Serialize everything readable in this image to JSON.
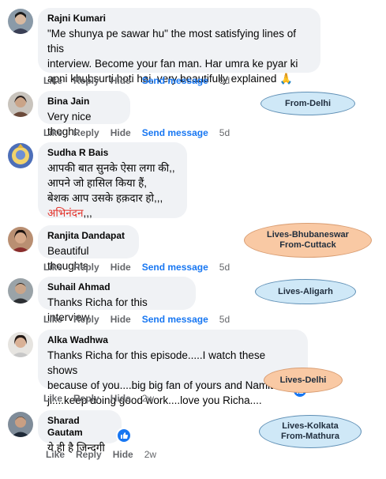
{
  "actions": {
    "like": "Like",
    "reply": "Reply",
    "hide": "Hide",
    "send_message": "Send message"
  },
  "comments": [
    {
      "name": "Rajni Kumari",
      "text": "\"Me shunya pe sawar hu\" the most satisfying lines of this\ninterview. Become your fan man. Har umra ke pyar ki\napni khubsurti hoti hai, very beautifully explained 🙏",
      "time": "5d"
    },
    {
      "name": "Bina Jain",
      "text": "Very nice thoght",
      "time": "5d"
    },
    {
      "name": "Sudha R Bais",
      "text": "आपकी बात सुनके ऐसा लगा की,,\nआपने जो हासिल किया हैं,\nबेशक आप उसके हक़दार हो,,,",
      "text_end": "अभिनंदन",
      "text_suffix": ",,,",
      "time": ""
    },
    {
      "name": "Ranjita Dandapat",
      "text": "Beautiful thoughts",
      "time": "5d"
    },
    {
      "name": "Suhail Ahmad",
      "text": "Thanks Richa for this interview",
      "time": "5d"
    },
    {
      "name": "Alka Wadhwa",
      "text": "Thanks Richa for this episode.....I watch these shows\nbecause of you....big big fan of yours and Namita\nji....keep doing good work....love you Richa....",
      "time": "2w"
    },
    {
      "name": "Sharad Gautam",
      "text": "ये ही है जिन्दगी",
      "time": "2w"
    }
  ],
  "tags": [
    {
      "text": "From-Delhi"
    },
    {
      "line1": "Lives-Bhubaneswar",
      "line2": "From-Cuttack"
    },
    {
      "text": "Lives-Aligarh"
    },
    {
      "text": "Lives-Delhi"
    },
    {
      "line1": "Lives-Kolkata",
      "line2": "From-Mathura"
    }
  ],
  "colors": {
    "link_blue": "#1877f2",
    "meta_gray": "#65676b",
    "bubble_bg": "#f0f2f5",
    "tag_blue": "#cfe8f7",
    "tag_orange": "#f9c9a4"
  }
}
